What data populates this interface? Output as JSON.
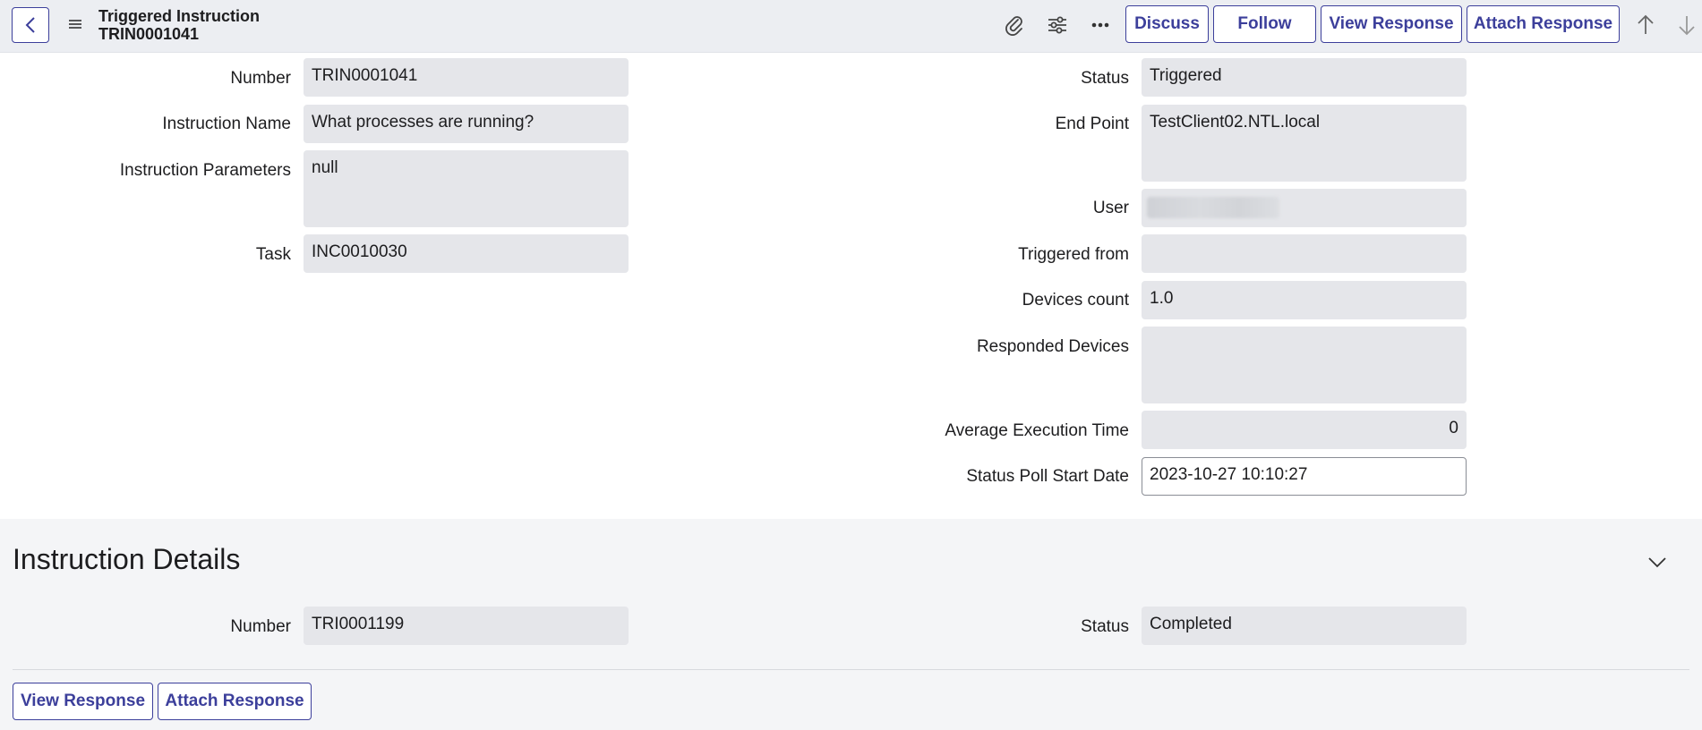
{
  "header": {
    "title": "Triggered Instruction",
    "record_number": "TRIN0001041",
    "buttons": {
      "discuss": "Discuss",
      "follow": "Follow",
      "view_response": "View Response",
      "attach_response": "Attach Response"
    },
    "icons": [
      "back-icon",
      "menu-icon",
      "paperclip-icon",
      "settings-sliders-icon",
      "more-options-icon",
      "arrow-up-icon",
      "arrow-down-icon"
    ]
  },
  "form": {
    "left": {
      "number": {
        "label": "Number",
        "value": "TRIN0001041"
      },
      "instruction_name": {
        "label": "Instruction Name",
        "value": "What processes are running?"
      },
      "instruction_parameters": {
        "label": "Instruction Parameters",
        "value": "null"
      },
      "task": {
        "label": "Task",
        "value": "INC0010030"
      }
    },
    "right": {
      "status": {
        "label": "Status",
        "value": "Triggered"
      },
      "end_point": {
        "label": "End Point",
        "value": "TestClient02.NTL.local"
      },
      "user": {
        "label": "User",
        "value": ""
      },
      "triggered_from": {
        "label": "Triggered from",
        "value": ""
      },
      "devices_count": {
        "label": "Devices count",
        "value": "1.0"
      },
      "responded_devices": {
        "label": "Responded Devices",
        "value": ""
      },
      "average_execution_time": {
        "label": "Average Execution Time",
        "value": "0"
      },
      "status_poll_start_date": {
        "label": "Status Poll Start Date",
        "value": "2023-10-27 10:10:27"
      }
    }
  },
  "instruction_details": {
    "title": "Instruction Details",
    "number": {
      "label": "Number",
      "value": "TRI0001199"
    },
    "status": {
      "label": "Status",
      "value": "Completed"
    }
  },
  "footer": {
    "view_response": "View Response",
    "attach_response": "Attach Response"
  },
  "colors": {
    "accent": "#3c3f9b",
    "header_bg": "#eceef2",
    "field_bg": "#e5e6ea",
    "section_bg": "#f4f5f7"
  }
}
